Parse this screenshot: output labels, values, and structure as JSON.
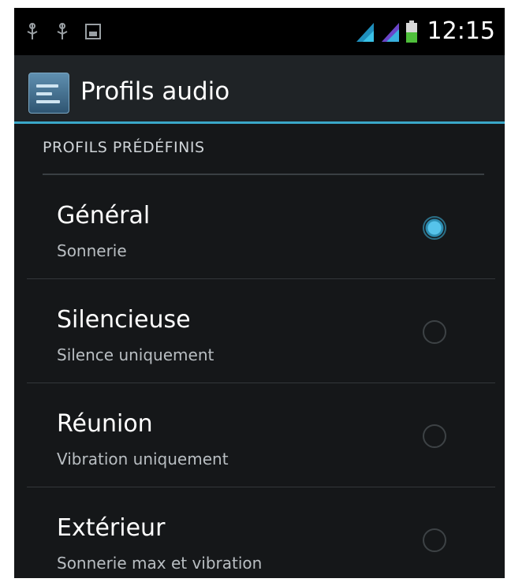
{
  "status_bar": {
    "time": "12:15",
    "icons": [
      "usb-icon",
      "usb-icon",
      "image-icon",
      "signal-icon",
      "signal-icon",
      "battery-icon"
    ]
  },
  "action_bar": {
    "icon": "audio-profiles-icon",
    "title": "Profils audio"
  },
  "section": {
    "header": "PROFILS PRÉDÉFINIS"
  },
  "profiles": [
    {
      "title": "Général",
      "subtitle": "Sonnerie",
      "selected": true
    },
    {
      "title": "Silencieuse",
      "subtitle": "Silence uniquement",
      "selected": false
    },
    {
      "title": "Réunion",
      "subtitle": "Vibration uniquement",
      "selected": false
    },
    {
      "title": "Extérieur",
      "subtitle": "Sonnerie max et vibration",
      "selected": false
    }
  ],
  "colors": {
    "accent": "#3aa7c8",
    "background": "#151719",
    "radio_selected": "#56c3ea"
  }
}
